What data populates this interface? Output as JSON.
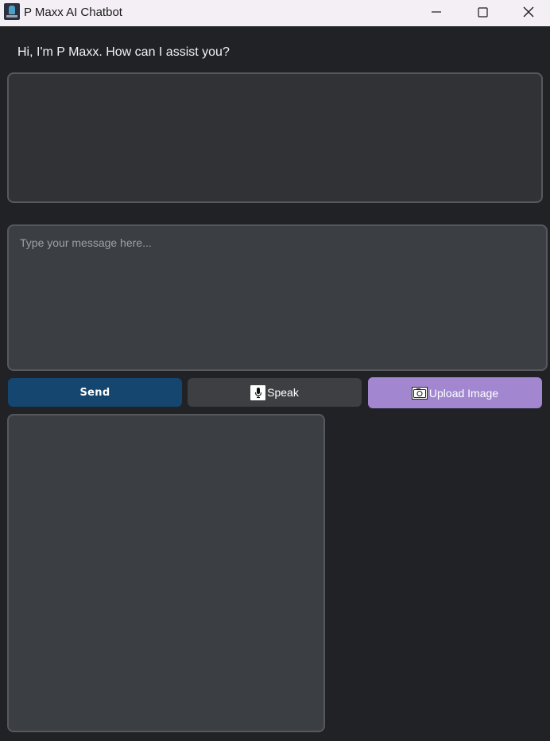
{
  "window": {
    "title": "P Maxx AI Chatbot",
    "controls": {
      "minimize_icon": "minimize-icon",
      "maximize_icon": "maximize-icon",
      "close_icon": "close-icon"
    }
  },
  "greeting": "Hi, I'm P Maxx. How can I assist you?",
  "response_area": {
    "text": ""
  },
  "message_input": {
    "value": "",
    "placeholder": "Type your message here..."
  },
  "buttons": {
    "send_label": "Send",
    "speak_label": "Speak",
    "speak_icon": "microphone-icon",
    "upload_label": "Upload Image",
    "upload_icon": "camera-icon"
  },
  "colors": {
    "background": "#212226",
    "send_button": "#15466f",
    "speak_button": "#3e3f42",
    "upload_button": "#a287d0"
  }
}
